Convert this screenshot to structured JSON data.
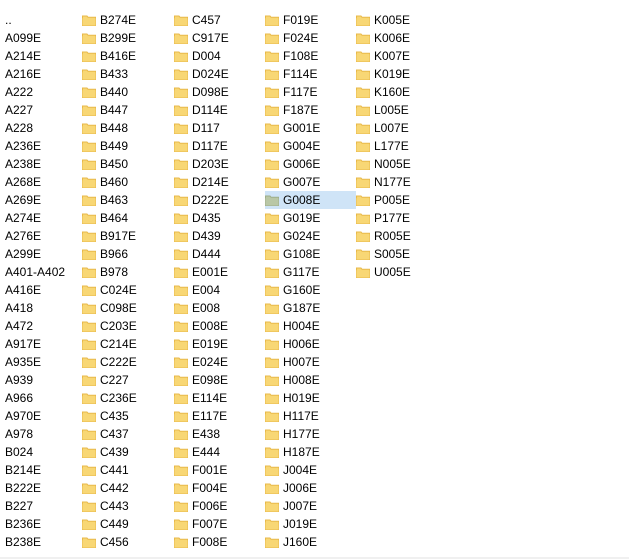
{
  "file_list": {
    "columns": [
      {
        "items": [
          {
            "name": ".."
          },
          {
            "name": "A099E"
          },
          {
            "name": "A214E"
          },
          {
            "name": "A216E"
          },
          {
            "name": "A222"
          },
          {
            "name": "A227"
          },
          {
            "name": "A228"
          },
          {
            "name": "A236E"
          },
          {
            "name": "A238E"
          },
          {
            "name": "A268E"
          },
          {
            "name": "A269E"
          },
          {
            "name": "A274E"
          },
          {
            "name": "A276E"
          },
          {
            "name": "A299E"
          },
          {
            "name": "A401-A402"
          },
          {
            "name": "A416E"
          },
          {
            "name": "A418"
          },
          {
            "name": "A472"
          },
          {
            "name": "A917E"
          },
          {
            "name": "A935E"
          },
          {
            "name": "A939"
          },
          {
            "name": "A966"
          },
          {
            "name": "A970E"
          },
          {
            "name": "A978"
          },
          {
            "name": "B024"
          },
          {
            "name": "B214E"
          },
          {
            "name": "B222E"
          },
          {
            "name": "B227"
          },
          {
            "name": "B236E"
          },
          {
            "name": "B238E"
          }
        ]
      },
      {
        "items": [
          {
            "name": "B274E"
          },
          {
            "name": "B299E"
          },
          {
            "name": "B416E"
          },
          {
            "name": "B433"
          },
          {
            "name": "B440"
          },
          {
            "name": "B447"
          },
          {
            "name": "B448"
          },
          {
            "name": "B449"
          },
          {
            "name": "B450"
          },
          {
            "name": "B460"
          },
          {
            "name": "B463"
          },
          {
            "name": "B464"
          },
          {
            "name": "B917E"
          },
          {
            "name": "B966"
          },
          {
            "name": "B978"
          },
          {
            "name": "C024E"
          },
          {
            "name": "C098E"
          },
          {
            "name": "C203E"
          },
          {
            "name": "C214E"
          },
          {
            "name": "C222E"
          },
          {
            "name": "C227"
          },
          {
            "name": "C236E"
          },
          {
            "name": "C435"
          },
          {
            "name": "C437"
          },
          {
            "name": "C439"
          },
          {
            "name": "C441"
          },
          {
            "name": "C442"
          },
          {
            "name": "C443"
          },
          {
            "name": "C449"
          },
          {
            "name": "C456"
          }
        ]
      },
      {
        "items": [
          {
            "name": "C457"
          },
          {
            "name": "C917E"
          },
          {
            "name": "D004"
          },
          {
            "name": "D024E"
          },
          {
            "name": "D098E"
          },
          {
            "name": "D114E"
          },
          {
            "name": "D117"
          },
          {
            "name": "D117E"
          },
          {
            "name": "D203E"
          },
          {
            "name": "D214E"
          },
          {
            "name": "D222E"
          },
          {
            "name": "D435"
          },
          {
            "name": "D439"
          },
          {
            "name": "D444"
          },
          {
            "name": "E001E"
          },
          {
            "name": "E004"
          },
          {
            "name": "E008"
          },
          {
            "name": "E008E"
          },
          {
            "name": "E019E"
          },
          {
            "name": "E024E"
          },
          {
            "name": "E098E"
          },
          {
            "name": "E114E"
          },
          {
            "name": "E117E"
          },
          {
            "name": "E438"
          },
          {
            "name": "E444"
          },
          {
            "name": "F001E"
          },
          {
            "name": "F004E"
          },
          {
            "name": "F006E"
          },
          {
            "name": "F007E"
          },
          {
            "name": "F008E"
          }
        ]
      },
      {
        "items": [
          {
            "name": "F019E"
          },
          {
            "name": "F024E"
          },
          {
            "name": "F108E"
          },
          {
            "name": "F114E"
          },
          {
            "name": "F117E"
          },
          {
            "name": "F187E"
          },
          {
            "name": "G001E"
          },
          {
            "name": "G004E"
          },
          {
            "name": "G006E"
          },
          {
            "name": "G007E"
          },
          {
            "name": "G008E",
            "selected": true
          },
          {
            "name": "G019E"
          },
          {
            "name": "G024E"
          },
          {
            "name": "G108E"
          },
          {
            "name": "G117E"
          },
          {
            "name": "G160E"
          },
          {
            "name": "G187E"
          },
          {
            "name": "H004E"
          },
          {
            "name": "H006E"
          },
          {
            "name": "H007E"
          },
          {
            "name": "H008E"
          },
          {
            "name": "H019E"
          },
          {
            "name": "H117E"
          },
          {
            "name": "H177E"
          },
          {
            "name": "H187E"
          },
          {
            "name": "J004E"
          },
          {
            "name": "J006E"
          },
          {
            "name": "J007E"
          },
          {
            "name": "J019E"
          },
          {
            "name": "J160E"
          }
        ]
      },
      {
        "items": [
          {
            "name": "K005E"
          },
          {
            "name": "K006E"
          },
          {
            "name": "K007E"
          },
          {
            "name": "K019E"
          },
          {
            "name": "K160E"
          },
          {
            "name": "L005E"
          },
          {
            "name": "L007E"
          },
          {
            "name": "L177E"
          },
          {
            "name": "N005E"
          },
          {
            "name": "N177E"
          },
          {
            "name": "P005E"
          },
          {
            "name": "P177E"
          },
          {
            "name": "R005E"
          },
          {
            "name": "S005E"
          },
          {
            "name": "U005E"
          }
        ]
      }
    ]
  },
  "colors": {
    "folder_fill": "#f8d775",
    "folder_tab": "#e8b94a",
    "folder_selected_fill": "#b9c7a6",
    "folder_selected_tab": "#9eae8a"
  },
  "icons": {
    "folder": "folder-icon"
  }
}
